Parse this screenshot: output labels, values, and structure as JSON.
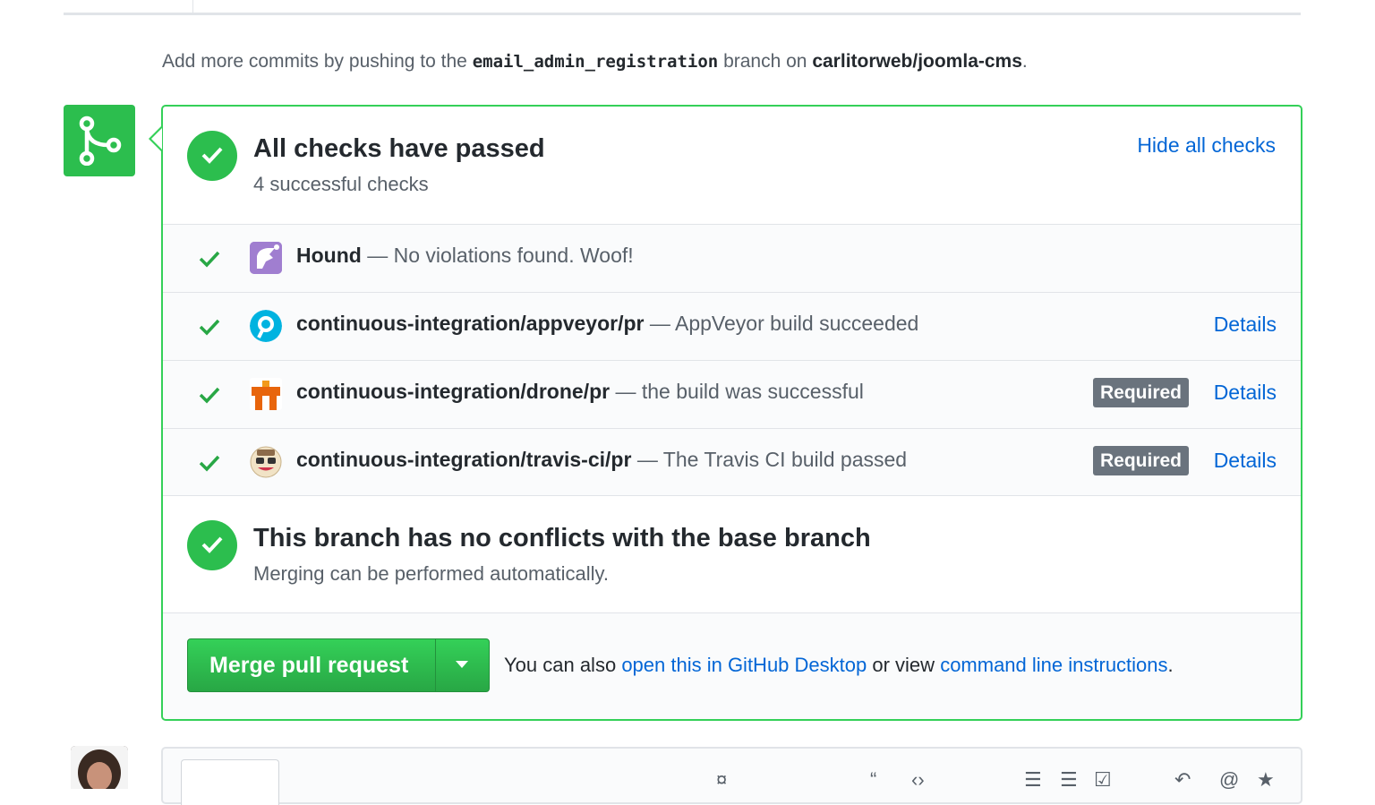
{
  "hint": {
    "prefix": "Add more commits by pushing to the",
    "branch": "email_admin_registration",
    "middle": "branch on",
    "repo": "carlitorweb/joomla-cms",
    "suffix": "."
  },
  "checks_section": {
    "title": "All checks have passed",
    "subtitle": "4 successful checks",
    "toggle_label": "Hide all checks"
  },
  "checks": [
    {
      "name": "Hound",
      "separator": "—",
      "description": "No violations found. Woof!",
      "icon": "hound-icon",
      "required": false,
      "details": ""
    },
    {
      "name": "continuous-integration/appveyor/pr",
      "separator": "—",
      "description": "AppVeyor build succeeded",
      "icon": "appveyor-icon",
      "required": false,
      "details": "Details"
    },
    {
      "name": "continuous-integration/drone/pr",
      "separator": "—",
      "description": "the build was successful",
      "icon": "drone-icon",
      "required": true,
      "required_label": "Required",
      "details": "Details"
    },
    {
      "name": "continuous-integration/travis-ci/pr",
      "separator": "—",
      "description": "The Travis CI build passed",
      "icon": "travis-ci-icon",
      "required": true,
      "required_label": "Required",
      "details": "Details"
    }
  ],
  "conflicts_section": {
    "title": "This branch has no conflicts with the base branch",
    "subtitle": "Merging can be performed automatically."
  },
  "merge": {
    "button_label": "Merge pull request",
    "info_prefix": "You can also",
    "desktop_link": "open this in GitHub Desktop",
    "info_middle": "or view",
    "cli_link": "command line instructions",
    "info_suffix": "."
  },
  "colors": {
    "success": "#2cbe4e",
    "border_success": "#34d058",
    "link": "#0366d6",
    "required_badge": "#6a737d",
    "muted_text": "#586069"
  }
}
